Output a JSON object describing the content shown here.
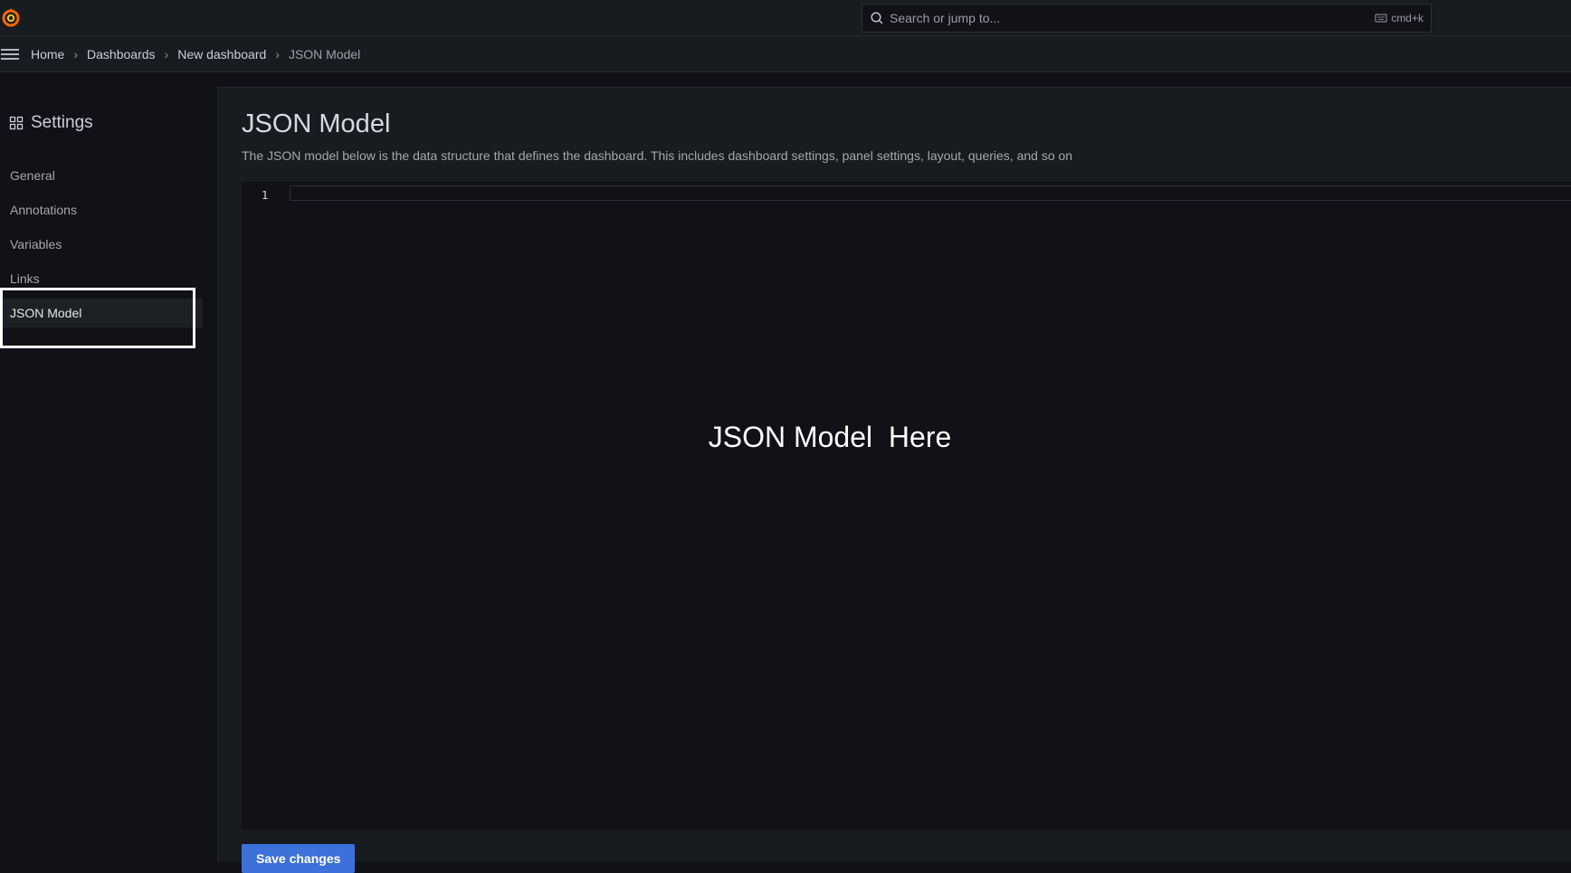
{
  "topbar": {
    "search": {
      "placeholder": "Search or jump to...",
      "shortcut": "cmd+k"
    }
  },
  "breadcrumb": {
    "items": [
      "Home",
      "Dashboards",
      "New dashboard",
      "JSON Model"
    ],
    "separator": "›"
  },
  "sidebar": {
    "title": "Settings",
    "items": [
      {
        "label": "General"
      },
      {
        "label": "Annotations"
      },
      {
        "label": "Variables"
      },
      {
        "label": "Links"
      },
      {
        "label": "JSON Model",
        "active": true
      }
    ]
  },
  "main": {
    "title": "JSON Model",
    "description": "The JSON model below is the data structure that defines the dashboard. This includes dashboard settings, panel settings, layout, queries, and so on",
    "editor": {
      "line_number": "1",
      "placeholder": "JSON Model  Here"
    },
    "save_label": "Save changes"
  },
  "colors": {
    "accent": "#3d71d9",
    "logo": "#f46800",
    "background": "#111217",
    "panel": "#181b1f"
  },
  "icons": {
    "logo": "grafana-logo",
    "menu": "hamburger-menu-icon",
    "search": "search-icon",
    "keyboard": "keyboard-icon",
    "settings": "apps-icon"
  }
}
